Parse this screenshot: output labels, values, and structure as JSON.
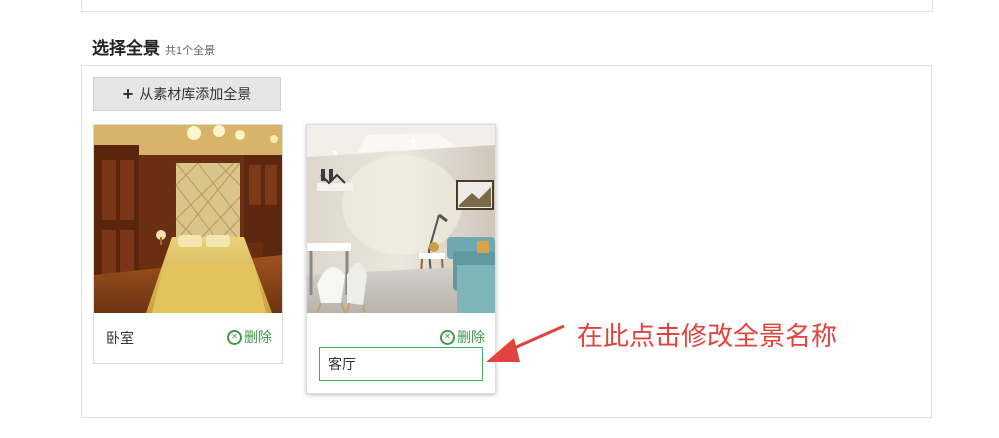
{
  "section": {
    "title": "选择全景",
    "count": "共1个全景"
  },
  "toolbar": {
    "add_label": "从素材库添加全景"
  },
  "cards": [
    {
      "name": "卧室",
      "delete_label": "删除"
    },
    {
      "delete_label": "删除",
      "input_value": "客厅"
    }
  ],
  "annotation": {
    "text": "在此点击修改全景名称",
    "color": "#e0443c"
  },
  "colors": {
    "accent_green": "#3f9a4a",
    "panel_border": "#e2e2e2"
  }
}
